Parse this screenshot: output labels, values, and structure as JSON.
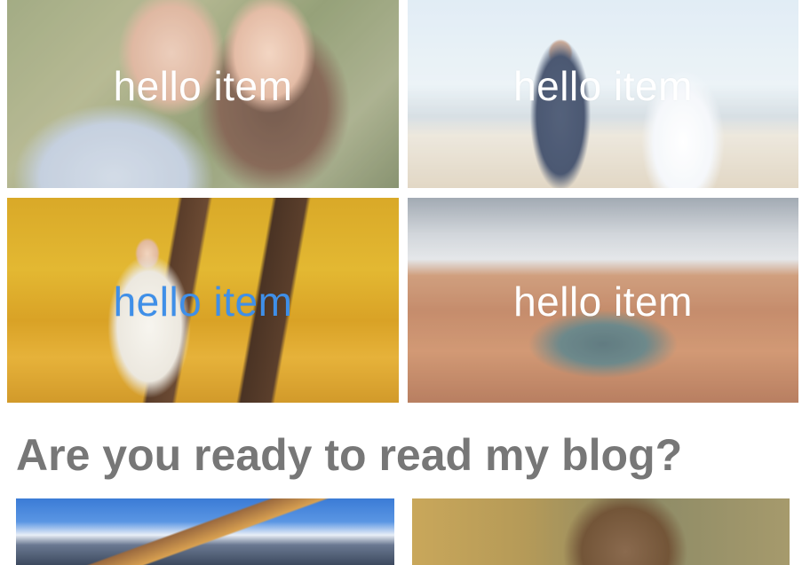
{
  "gallery": {
    "items": [
      {
        "caption": "hello item",
        "image": "couple-embracing-photo"
      },
      {
        "caption": "hello item",
        "image": "bride-groom-beach-photo"
      },
      {
        "caption": "hello item",
        "image": "bride-autumn-bench-photo"
      },
      {
        "caption": "hello item",
        "image": "canyon-river-bend-photo"
      }
    ],
    "highlight_caption_color": "#3f8fe8",
    "caption_color": "#ffffff"
  },
  "blog": {
    "heading": "Are you ready to read my blog?",
    "heading_color": "#777777",
    "cards": [
      {
        "image": "mountain-lake-photo"
      },
      {
        "image": "bear-cub-photo"
      }
    ]
  }
}
